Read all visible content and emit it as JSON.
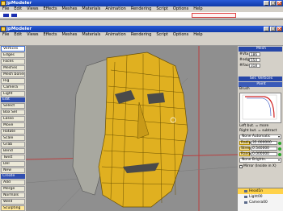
{
  "outer_window": {
    "title": "jpModeler"
  },
  "outer_menu": [
    "File",
    "Edit",
    "Views",
    "Effects",
    "Meshes",
    "Materials",
    "Animation",
    "Rendering",
    "Script",
    "Options",
    "Help"
  ],
  "inner_window": {
    "title": "jpModeler"
  },
  "inner_menu": [
    "File",
    "Edit",
    "Views",
    "Effects",
    "Meshes",
    "Materials",
    "Animation",
    "Rendering",
    "Script",
    "Options",
    "Help"
  ],
  "left_panel": {
    "items_top": [
      "Vertices",
      "Edges",
      "Faces",
      "Meshes",
      "Mesh bones",
      "Rig",
      "Camera",
      "Light"
    ],
    "section_edit": "Edit",
    "items_edit": [
      "Select",
      "Box Sel",
      "Lasso",
      "Move",
      "Rotate",
      "Scale",
      "Grab",
      "Bend",
      "Twist",
      "Del",
      "New"
    ],
    "section_create": "Create",
    "items_create": [
      "Add",
      "Merge",
      "Normals",
      "Weld",
      "Sculpting"
    ]
  },
  "right_panel": {
    "mesh_header": "Mesh",
    "stats": [
      {
        "label": "#Vtx",
        "value": "186"
      },
      {
        "label": "#edges",
        "value": "554"
      },
      {
        "label": "#Faces",
        "value": "318"
      }
    ],
    "sel_header": "Sel. Vertices",
    "paint_header": "Paint",
    "brush_label": "Brush",
    "hint1": "Left but. = more",
    "hint2": "Right but. = subtract",
    "mode1": "None   Automatic",
    "sliders": [
      {
        "label": "Radius",
        "value": "35.000000"
      },
      {
        "label": "Strength",
        "value": "0.540000"
      },
      {
        "label": "Random",
        "value": "0.000000"
      }
    ],
    "mode2": "None   Brightn.",
    "mirror_label": "Mirror  (Inside in X)",
    "scene_items": [
      "Head1n",
      "Light00",
      "Camera00"
    ]
  }
}
